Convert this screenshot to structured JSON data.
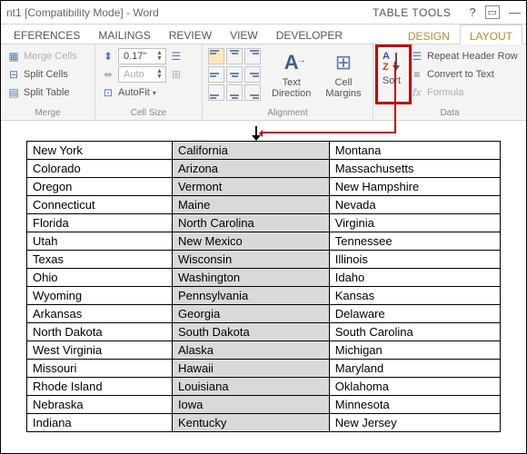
{
  "titlebar": {
    "title": "nt1 [Compatibility Mode] - Word",
    "tools_label": "TABLE TOOLS"
  },
  "tabs": {
    "main": [
      "EFERENCES",
      "MAILINGS",
      "REVIEW",
      "VIEW",
      "DEVELOPER"
    ],
    "tools": [
      "DESIGN",
      "LAYOUT"
    ],
    "active_tool": "LAYOUT"
  },
  "ribbon": {
    "merge": {
      "label": "Merge",
      "merge_cells": "Merge Cells",
      "split_cells": "Split Cells",
      "split_table": "Split Table"
    },
    "cell_size": {
      "label": "Cell Size",
      "height_value": "0.17\"",
      "width_value": "Auto",
      "autofit": "AutoFit"
    },
    "alignment": {
      "label": "Alignment",
      "text_direction": "Text Direction",
      "cell_margins": "Cell Margins"
    },
    "data": {
      "label": "Data",
      "sort": "Sort",
      "repeat_header": "Repeat Header Row",
      "convert_text": "Convert to Text",
      "formula": "Formula"
    }
  },
  "table": {
    "rows": [
      [
        "New York",
        "California",
        "Montana"
      ],
      [
        "Colorado",
        "Arizona",
        "Massachusetts"
      ],
      [
        "Oregon",
        "Vermont",
        "New Hampshire"
      ],
      [
        "Connecticut",
        "Maine",
        "Nevada"
      ],
      [
        "Florida",
        "North Carolina",
        "Virginia"
      ],
      [
        "Utah",
        "New Mexico",
        "Tennessee"
      ],
      [
        "Texas",
        "Wisconsin",
        "Illinois"
      ],
      [
        "Ohio",
        "Washington",
        "Idaho"
      ],
      [
        "Wyoming",
        "Pennsylvania",
        "Kansas"
      ],
      [
        "Arkansas",
        "Georgia",
        "Delaware"
      ],
      [
        "North Dakota",
        "South Dakota",
        "South Carolina"
      ],
      [
        "West Virginia",
        "Alaska",
        "Michigan"
      ],
      [
        "Missouri",
        "Hawaii",
        "Maryland"
      ],
      [
        "Rhode Island",
        "Louisiana",
        "Oklahoma"
      ],
      [
        "Nebraska",
        "Iowa",
        "Minnesota"
      ],
      [
        "Indiana",
        "Kentucky",
        "New Jersey"
      ]
    ]
  }
}
